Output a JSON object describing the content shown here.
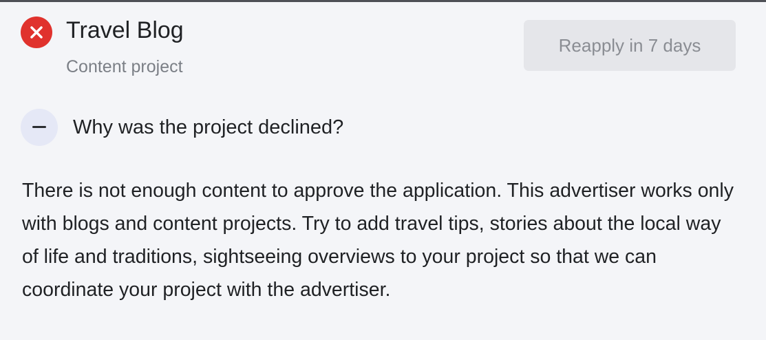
{
  "project": {
    "title": "Travel Blog",
    "subtitle": "Content project",
    "status_icon": "close-circle-icon",
    "status_color": "#e0322d"
  },
  "actions": {
    "reapply_label": "Reapply in 7 days"
  },
  "decline_reason": {
    "toggle_icon": "minus-icon",
    "question": "Why was the project declined?",
    "explanation": "There is not enough content to approve the application. This advertiser works only with blogs and content projects. Try to add travel tips, stories about the local way of life and traditions, sightseeing overviews to your project so that we can coordinate your project with the advertiser."
  }
}
